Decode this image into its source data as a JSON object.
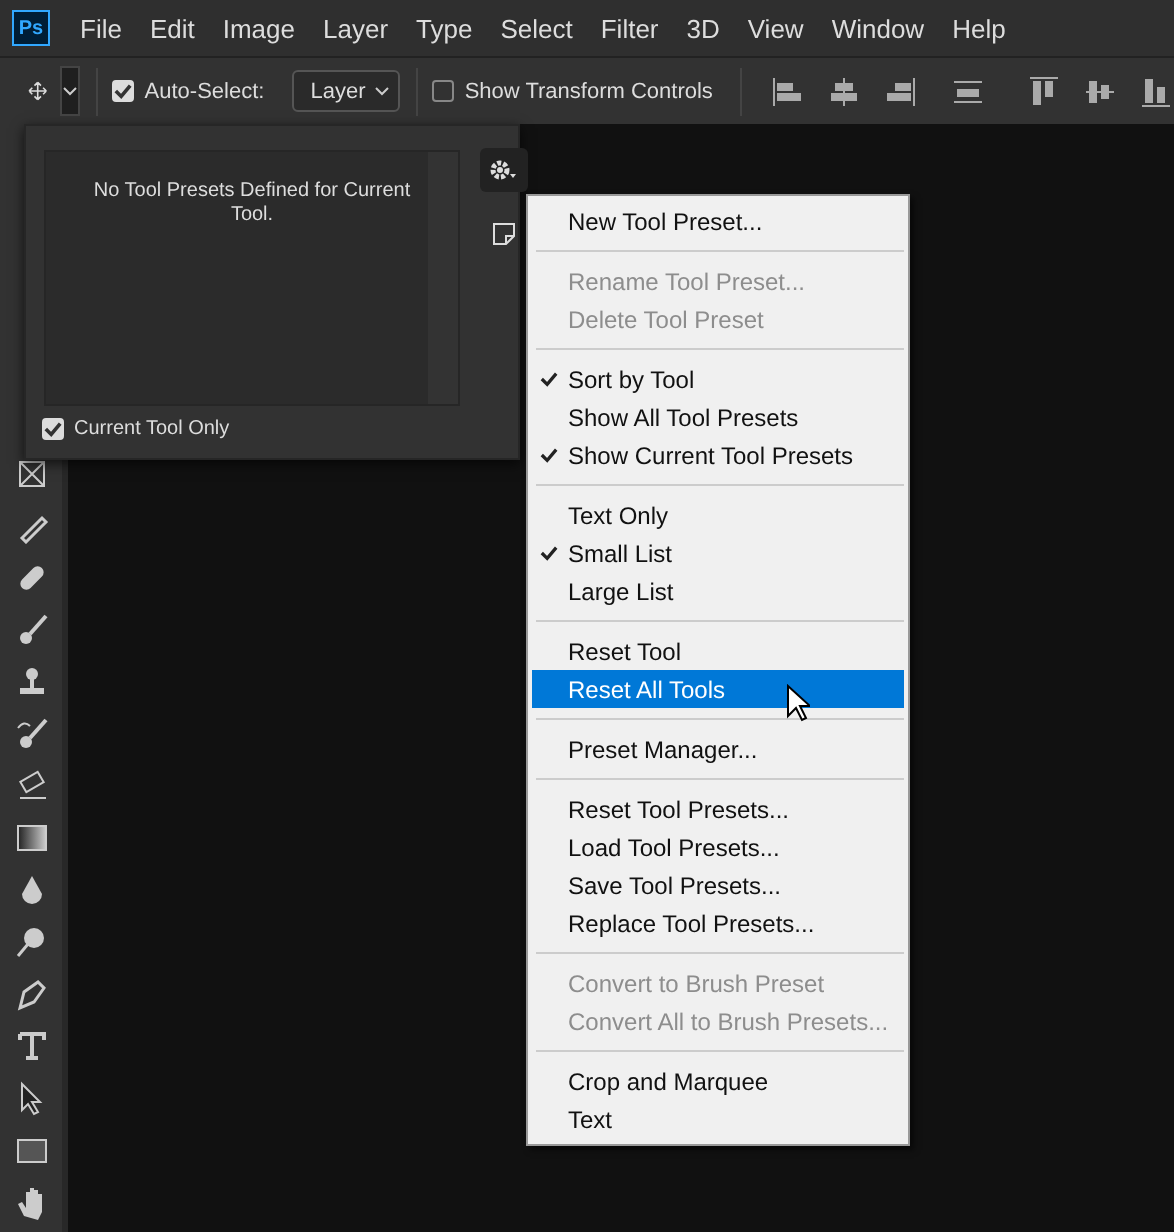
{
  "app_logo": "Ps",
  "menu_bar": [
    "File",
    "Edit",
    "Image",
    "Layer",
    "Type",
    "Select",
    "Filter",
    "3D",
    "View",
    "Window",
    "Help"
  ],
  "options_bar": {
    "auto_select": {
      "label": "Auto-Select:",
      "checked": true
    },
    "target": {
      "value": "Layer"
    },
    "transform_controls": {
      "label": "Show Transform Controls",
      "checked": false
    }
  },
  "tool_presets_panel": {
    "empty_message": "No Tool Presets Defined for Current Tool.",
    "current_tool_only": {
      "label": "Current Tool Only",
      "checked": true
    }
  },
  "panel_menu": [
    [
      {
        "label": "New Tool Preset...",
        "checked": false,
        "disabled": false,
        "selected": false
      }
    ],
    [
      {
        "label": "Rename Tool Preset...",
        "checked": false,
        "disabled": true,
        "selected": false
      },
      {
        "label": "Delete Tool Preset",
        "checked": false,
        "disabled": true,
        "selected": false
      }
    ],
    [
      {
        "label": "Sort by Tool",
        "checked": true,
        "disabled": false,
        "selected": false
      },
      {
        "label": "Show All Tool Presets",
        "checked": false,
        "disabled": false,
        "selected": false
      },
      {
        "label": "Show Current Tool Presets",
        "checked": true,
        "disabled": false,
        "selected": false
      }
    ],
    [
      {
        "label": "Text Only",
        "checked": false,
        "disabled": false,
        "selected": false
      },
      {
        "label": "Small List",
        "checked": true,
        "disabled": false,
        "selected": false
      },
      {
        "label": "Large List",
        "checked": false,
        "disabled": false,
        "selected": false
      }
    ],
    [
      {
        "label": "Reset Tool",
        "checked": false,
        "disabled": false,
        "selected": false
      },
      {
        "label": "Reset All Tools",
        "checked": false,
        "disabled": false,
        "selected": true
      }
    ],
    [
      {
        "label": "Preset Manager...",
        "checked": false,
        "disabled": false,
        "selected": false
      }
    ],
    [
      {
        "label": "Reset Tool Presets...",
        "checked": false,
        "disabled": false,
        "selected": false
      },
      {
        "label": "Load Tool Presets...",
        "checked": false,
        "disabled": false,
        "selected": false
      },
      {
        "label": "Save Tool Presets...",
        "checked": false,
        "disabled": false,
        "selected": false
      },
      {
        "label": "Replace Tool Presets...",
        "checked": false,
        "disabled": false,
        "selected": false
      }
    ],
    [
      {
        "label": "Convert to Brush Preset",
        "checked": false,
        "disabled": true,
        "selected": false
      },
      {
        "label": "Convert All to Brush Presets...",
        "checked": false,
        "disabled": true,
        "selected": false
      }
    ],
    [
      {
        "label": "Crop and Marquee",
        "checked": false,
        "disabled": false,
        "selected": false
      },
      {
        "label": "Text",
        "checked": false,
        "disabled": false,
        "selected": false
      }
    ]
  ]
}
